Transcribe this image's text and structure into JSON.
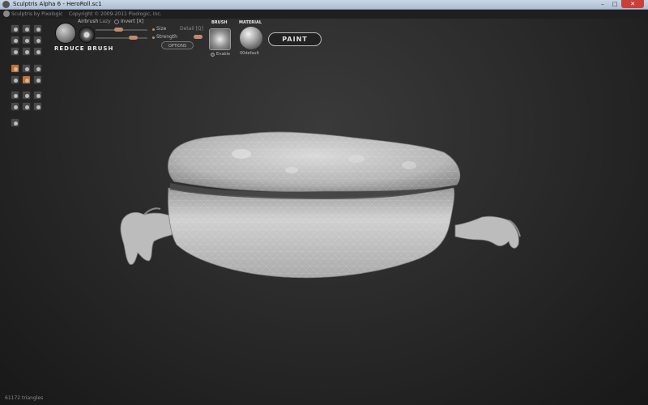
{
  "window": {
    "title": "Sculptris Alpha 6 - HeroRoll.sc1",
    "minimize": "–",
    "maximize": "□",
    "close": "✕"
  },
  "header": {
    "brand": "Sculptris by Pixologic",
    "copyright": "Copyright © 2009-2011 Pixologic, Inc."
  },
  "brush_panel": {
    "brush_name": "REDUCE BRUSH",
    "airbrush_label": "Airbrush",
    "lazy_label": "Lazy",
    "invert_label": "Invert [X]",
    "size_label": "Size",
    "strength_label": "Strength",
    "detail_label": "Detail [Q]",
    "options_label": "OPTIONS"
  },
  "brush_section": {
    "header": "BRUSH",
    "enable_label": "Enable"
  },
  "material_section": {
    "header": "MATERIAL",
    "name": "00default"
  },
  "paint_button": "PAINT",
  "tools": [
    {
      "icon": "draw-icon"
    },
    {
      "icon": "rotate-icon"
    },
    {
      "icon": "crease-icon"
    },
    {
      "icon": "flatten-icon"
    },
    {
      "icon": "inflate-icon"
    },
    {
      "icon": "pinch-icon"
    },
    {
      "icon": "smooth-icon"
    },
    {
      "icon": "grab-icon"
    },
    {
      "icon": "scale-icon"
    },
    {
      "icon": "reduce-icon",
      "active": true
    },
    {
      "icon": "mask-icon",
      "active": false
    },
    {
      "icon": "symmetry-icon"
    },
    {
      "icon": "wireframe-icon"
    },
    {
      "icon": "grid-icon",
      "active": true
    },
    {
      "icon": "subdivide-icon"
    },
    {
      "icon": "sphere-icon"
    },
    {
      "icon": "plane-icon"
    },
    {
      "icon": "mirror-icon"
    },
    {
      "icon": "import-icon"
    },
    {
      "icon": "export-icon"
    },
    {
      "icon": "save-icon"
    },
    {
      "icon": "settings-icon"
    }
  ],
  "status": {
    "triangles": "61172 triangles"
  },
  "colors": {
    "accent": "#c9702f",
    "model": "#cfcfcf",
    "background": "#2a2a2a"
  }
}
